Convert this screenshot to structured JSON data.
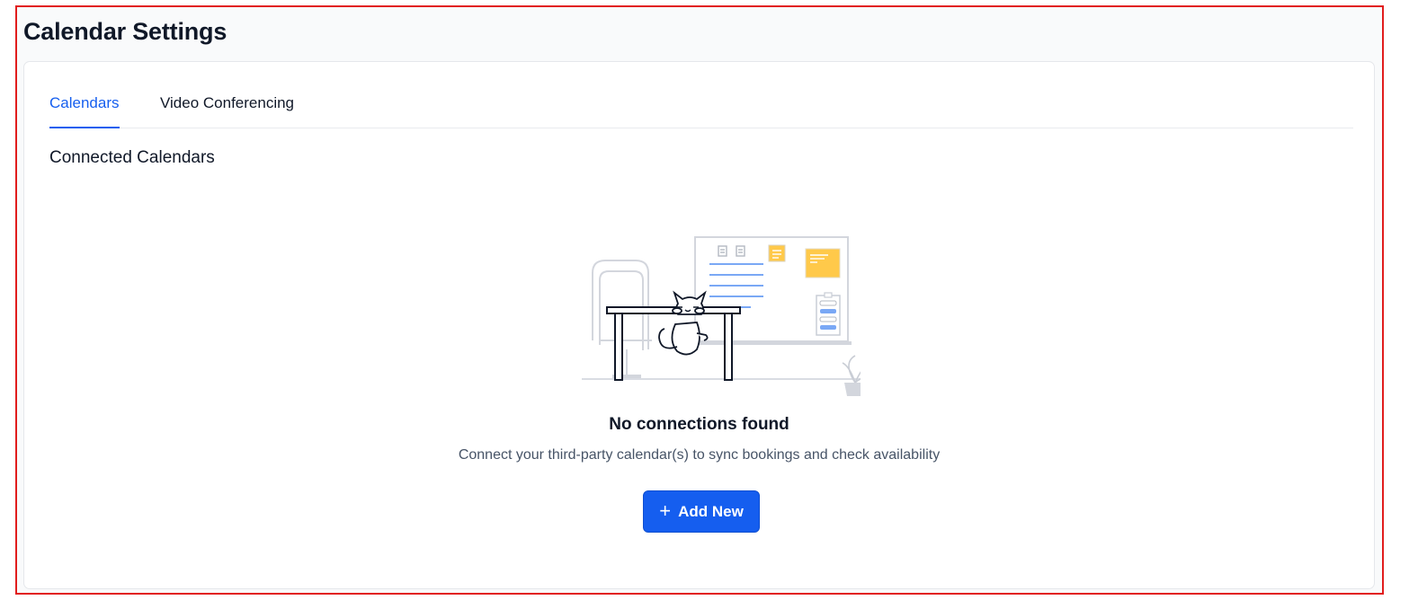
{
  "page": {
    "title": "Calendar Settings"
  },
  "tabs": [
    {
      "label": "Calendars",
      "active": true
    },
    {
      "label": "Video Conferencing",
      "active": false
    }
  ],
  "section": {
    "title": "Connected Calendars"
  },
  "empty_state": {
    "illustration": "cat-on-desk-illustration",
    "title": "No connections found",
    "subtitle": "Connect your third-party calendar(s) to sync bookings and check availability"
  },
  "actions": {
    "add_new_label": "Add New",
    "add_new_icon": "plus-icon"
  },
  "colors": {
    "accent": "#155eef",
    "text_primary": "#101828",
    "text_secondary": "#475467",
    "highlight_border": "#e11d1d"
  }
}
